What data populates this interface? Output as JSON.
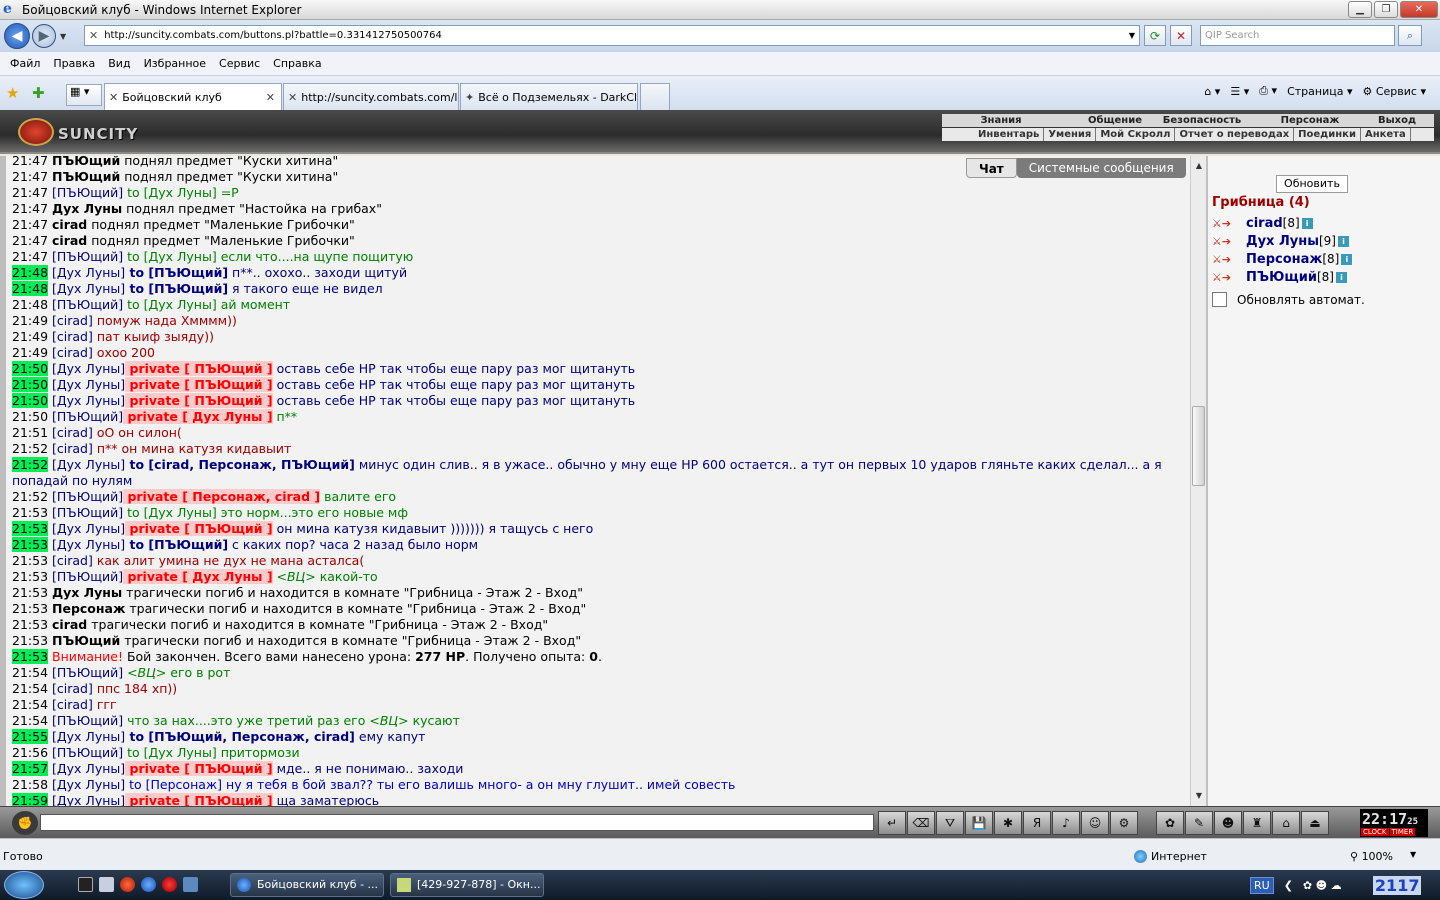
{
  "window": {
    "title": "Бойцовский клуб - Windows Internet Explorer"
  },
  "browser": {
    "url": "http://suncity.combats.com/buttons.pl?battle=0.331412750500764",
    "search_placeholder": "QIP Search",
    "menu": [
      "Файл",
      "Правка",
      "Вид",
      "Избранное",
      "Сервис",
      "Справка"
    ],
    "tabs": [
      {
        "label": "Бойцовский клуб",
        "active": true
      },
      {
        "label": "http://suncity.combats.com/l...",
        "active": false
      },
      {
        "label": "Всё о Подземельях - DarkCl...",
        "active": false
      }
    ],
    "tools": {
      "page_label": "Страница",
      "service_label": "Сервис"
    },
    "status_text": "Готово",
    "zone": "Интернет",
    "zoom": "100%"
  },
  "game": {
    "logo_text": "SUNCITY",
    "top_menu_1": [
      "Знания",
      "Общение",
      "Безопасность",
      "Персонаж",
      "Выход"
    ],
    "top_menu_2": [
      "Инвентарь",
      "Умения",
      "Мой Скролл",
      "Отчет о переводах",
      "Поединки",
      "Анкета"
    ],
    "chat_tabs": [
      "Чат",
      "Системные сообщения"
    ],
    "refresh_label": "Обновить",
    "room": {
      "name": "Грибница",
      "count": "(4)"
    },
    "users": [
      {
        "name": "cirad",
        "level": "[8]"
      },
      {
        "name": "Дух Луны",
        "level": "[9]"
      },
      {
        "name": "Персонаж",
        "level": "[8]"
      },
      {
        "name": "ПЪЮщий",
        "level": "[8]"
      }
    ],
    "auto_refresh_label": "Обновлять автомат.",
    "clock": {
      "time": "22:17",
      "seconds": "25",
      "label_clock": "CLOCK",
      "label_timer": "TIMER"
    }
  },
  "taskbar": {
    "buttons": [
      "Бойцовский клуб - ...",
      "[429-927-878] - Окн..."
    ],
    "lang": "RU",
    "time": "2117"
  },
  "chat": [
    {
      "t": "21:47",
      "hl": false,
      "parts": [
        {
          "k": "sysnick",
          "v": "ПЪЮщий"
        },
        {
          "k": "msg-gray",
          "v": " поднял предмет \"Куски хитина\""
        }
      ]
    },
    {
      "t": "21:47",
      "hl": false,
      "parts": [
        {
          "k": "sysnick",
          "v": "ПЪЮщий"
        },
        {
          "k": "msg-gray",
          "v": " поднял предмет \"Куски хитина\""
        }
      ]
    },
    {
      "t": "21:47",
      "hl": false,
      "parts": [
        {
          "k": "nick",
          "v": "[ПЪЮщий]"
        },
        {
          "k": "msg-green",
          "v": " to [Дух Луны] =P"
        }
      ]
    },
    {
      "t": "21:47",
      "hl": false,
      "parts": [
        {
          "k": "sysnick",
          "v": "Дух Луны"
        },
        {
          "k": "msg-gray",
          "v": " поднял предмет \"Настойка на грибах\""
        }
      ]
    },
    {
      "t": "21:47",
      "hl": false,
      "parts": [
        {
          "k": "sysnick",
          "v": "cirad"
        },
        {
          "k": "msg-gray",
          "v": " поднял предмет \"Маленькие Грибочки\""
        }
      ]
    },
    {
      "t": "21:47",
      "hl": false,
      "parts": [
        {
          "k": "sysnick",
          "v": "cirad"
        },
        {
          "k": "msg-gray",
          "v": " поднял предмет \"Маленькие Грибочки\""
        }
      ]
    },
    {
      "t": "21:47",
      "hl": false,
      "parts": [
        {
          "k": "nick",
          "v": "[ПЪЮщий]"
        },
        {
          "k": "msg-green",
          "v": " to [Дух Луны] если что....на щупе пощитую"
        }
      ]
    },
    {
      "t": "21:48",
      "hl": true,
      "parts": [
        {
          "k": "nick",
          "v": "[Дух Луны]"
        },
        {
          "k": "to",
          "v": " to [ПЪЮщий]"
        },
        {
          "k": "msg-navy",
          "v": " п**.. охохо.. заходи щитуй"
        }
      ]
    },
    {
      "t": "21:48",
      "hl": true,
      "parts": [
        {
          "k": "nick",
          "v": "[Дух Луны]"
        },
        {
          "k": "to",
          "v": " to [ПЪЮщий]"
        },
        {
          "k": "msg-navy",
          "v": " я такого еще не видел"
        }
      ]
    },
    {
      "t": "21:48",
      "hl": false,
      "parts": [
        {
          "k": "nick",
          "v": "[ПЪЮщий]"
        },
        {
          "k": "msg-green",
          "v": " to [Дух Луны] ай момент"
        }
      ]
    },
    {
      "t": "21:49",
      "hl": false,
      "parts": [
        {
          "k": "nick",
          "v": "[cirad]"
        },
        {
          "k": "msg-red",
          "v": " помуж нада Хмммм))"
        }
      ]
    },
    {
      "t": "21:49",
      "hl": false,
      "parts": [
        {
          "k": "nick",
          "v": "[cirad]"
        },
        {
          "k": "msg-red",
          "v": " пат кыиф зыяду))"
        }
      ]
    },
    {
      "t": "21:49",
      "hl": false,
      "parts": [
        {
          "k": "nick",
          "v": "[cirad]"
        },
        {
          "k": "msg-red",
          "v": " охоо 200"
        }
      ]
    },
    {
      "t": "21:50",
      "hl": true,
      "parts": [
        {
          "k": "nick",
          "v": "[Дух Луны]"
        },
        {
          "k": "priv",
          "v": " private [ ПЪЮщий ]"
        },
        {
          "k": "msg-navy",
          "v": " оставь себе НР так чтобы еще пару раз мог щитануть"
        }
      ]
    },
    {
      "t": "21:50",
      "hl": true,
      "parts": [
        {
          "k": "nick",
          "v": "[Дух Луны]"
        },
        {
          "k": "priv",
          "v": " private [ ПЪЮщий ]"
        },
        {
          "k": "msg-navy",
          "v": " оставь себе НР так чтобы еще пару раз мог щитануть"
        }
      ]
    },
    {
      "t": "21:50",
      "hl": true,
      "parts": [
        {
          "k": "nick",
          "v": "[Дух Луны]"
        },
        {
          "k": "priv",
          "v": " private [ ПЪЮщий ]"
        },
        {
          "k": "msg-navy",
          "v": " оставь себе НР так чтобы еще пару раз мог щитануть"
        }
      ]
    },
    {
      "t": "21:50",
      "hl": false,
      "parts": [
        {
          "k": "nick",
          "v": "[ПЪЮщий]"
        },
        {
          "k": "priv",
          "v": " private [ Дух Луны ]"
        },
        {
          "k": "msg-green",
          "v": " п**"
        }
      ]
    },
    {
      "t": "21:51",
      "hl": false,
      "parts": [
        {
          "k": "nick",
          "v": "[cirad]"
        },
        {
          "k": "msg-red",
          "v": " оО он силон("
        }
      ]
    },
    {
      "t": "21:52",
      "hl": false,
      "parts": [
        {
          "k": "nick",
          "v": "[cirad]"
        },
        {
          "k": "msg-red",
          "v": " п** он мина катузя кидавыит"
        }
      ]
    },
    {
      "t": "21:52",
      "hl": true,
      "wrap": true,
      "parts": [
        {
          "k": "nick",
          "v": "[Дух Луны]"
        },
        {
          "k": "to",
          "v": " to [cirad, Персонаж, ПЪЮщий]"
        },
        {
          "k": "msg-navy",
          "v": " минус один слив.. я в ужасе.. обычно у мну еще НР 600 остается.. а тут он первых 10 ударов гляньте каких сделал... а я попадай по нулям"
        }
      ]
    },
    {
      "t": "21:52",
      "hl": false,
      "parts": [
        {
          "k": "nick",
          "v": "[ПЪЮщий]"
        },
        {
          "k": "priv",
          "v": " private [ Персонаж, cirad ]"
        },
        {
          "k": "msg-green",
          "v": " валите его"
        }
      ]
    },
    {
      "t": "21:53",
      "hl": false,
      "parts": [
        {
          "k": "nick",
          "v": "[ПЪЮщий]"
        },
        {
          "k": "msg-green",
          "v": " to [Дух Луны] это норм...это его новые мф"
        }
      ]
    },
    {
      "t": "21:53",
      "hl": true,
      "parts": [
        {
          "k": "nick",
          "v": "[Дух Луны]"
        },
        {
          "k": "priv",
          "v": " private [ ПЪЮщий ]"
        },
        {
          "k": "msg-navy",
          "v": " он мина катузя кидавыит ))))))) я тащусь с него"
        }
      ]
    },
    {
      "t": "21:53",
      "hl": true,
      "parts": [
        {
          "k": "nick",
          "v": "[Дух Луны]"
        },
        {
          "k": "to",
          "v": " to [ПЪЮщий]"
        },
        {
          "k": "msg-navy",
          "v": " с каких пор? часа 2 назад было норм"
        }
      ]
    },
    {
      "t": "21:53",
      "hl": false,
      "parts": [
        {
          "k": "nick",
          "v": "[cirad]"
        },
        {
          "k": "msg-red",
          "v": " как алит умина не дух не мана асталса("
        }
      ]
    },
    {
      "t": "21:53",
      "hl": false,
      "parts": [
        {
          "k": "nick",
          "v": "[ПЪЮщий]"
        },
        {
          "k": "priv",
          "v": " private [ Дух Луны ]"
        },
        {
          "k": "vc",
          "v": " <ВЦ>"
        },
        {
          "k": "msg-green",
          "v": " какой-то"
        }
      ]
    },
    {
      "t": "21:53",
      "hl": false,
      "parts": [
        {
          "k": "sysnick",
          "v": "Дух Луны"
        },
        {
          "k": "msg-gray",
          "v": " трагически погиб и находится в комнате \"Грибница - Этаж 2 - Вход\""
        }
      ]
    },
    {
      "t": "21:53",
      "hl": false,
      "parts": [
        {
          "k": "sysnick",
          "v": "Персонаж"
        },
        {
          "k": "msg-gray",
          "v": " трагически погиб и находится в комнате \"Грибница - Этаж 2 - Вход\""
        }
      ]
    },
    {
      "t": "21:53",
      "hl": false,
      "parts": [
        {
          "k": "sysnick",
          "v": "cirad"
        },
        {
          "k": "msg-gray",
          "v": " трагически погиб и находится в комнате \"Грибница - Этаж 2 - Вход\""
        }
      ]
    },
    {
      "t": "21:53",
      "hl": false,
      "parts": [
        {
          "k": "sysnick",
          "v": "ПЪЮщий"
        },
        {
          "k": "msg-gray",
          "v": " трагически погиб и находится в комнате \"Грибница - Этаж 2 - Вход\""
        }
      ]
    },
    {
      "t": "21:53",
      "hl": true,
      "parts": [
        {
          "k": "alert",
          "v": "Внимание!"
        },
        {
          "k": "msg-gray",
          "v": " Бой закончен. Всего вами нанесено урона: "
        },
        {
          "k": "sysnick",
          "v": "277 HP"
        },
        {
          "k": "msg-gray",
          "v": ". Получено опыта: "
        },
        {
          "k": "sysnick",
          "v": "0"
        },
        {
          "k": "msg-gray",
          "v": "."
        }
      ]
    },
    {
      "t": "21:54",
      "hl": false,
      "parts": [
        {
          "k": "nick",
          "v": "[ПЪЮщий]"
        },
        {
          "k": "vc",
          "v": " <ВЦ>"
        },
        {
          "k": "msg-green",
          "v": " его в рот"
        }
      ]
    },
    {
      "t": "21:54",
      "hl": false,
      "parts": [
        {
          "k": "nick",
          "v": "[cirad]"
        },
        {
          "k": "msg-red",
          "v": " ппс 184 хп))"
        }
      ]
    },
    {
      "t": "21:54",
      "hl": false,
      "parts": [
        {
          "k": "nick",
          "v": "[cirad]"
        },
        {
          "k": "msg-red",
          "v": " ггг"
        }
      ]
    },
    {
      "t": "21:54",
      "hl": false,
      "parts": [
        {
          "k": "nick",
          "v": "[ПЪЮщий]"
        },
        {
          "k": "msg-green",
          "v": " что за нах....это уже третий раз его "
        },
        {
          "k": "vc",
          "v": "<ВЦ>"
        },
        {
          "k": "msg-green",
          "v": " кусают"
        }
      ]
    },
    {
      "t": "21:55",
      "hl": true,
      "parts": [
        {
          "k": "nick",
          "v": "[Дух Луны]"
        },
        {
          "k": "to",
          "v": " to [ПЪЮщий, Персонаж, cirad]"
        },
        {
          "k": "msg-navy",
          "v": " ему капут"
        }
      ]
    },
    {
      "t": "21:56",
      "hl": false,
      "parts": [
        {
          "k": "nick",
          "v": "[ПЪЮщий]"
        },
        {
          "k": "msg-green",
          "v": " to [Дух Луны] притормози"
        }
      ]
    },
    {
      "t": "21:57",
      "hl": true,
      "parts": [
        {
          "k": "nick",
          "v": "[Дух Луны]"
        },
        {
          "k": "priv",
          "v": " private [ ПЪЮщий ]"
        },
        {
          "k": "msg-navy",
          "v": " мде.. я не понимаю.. заходи"
        }
      ]
    },
    {
      "t": "21:58",
      "hl": false,
      "parts": [
        {
          "k": "nick",
          "v": "[Дух Луны]"
        },
        {
          "k": "msg-blue",
          "v": " to [Персонаж] ну я тебя в бой звал?? ты его валишь много- а он мну глушит.. имей совесть"
        }
      ]
    },
    {
      "t": "21:59",
      "hl": true,
      "parts": [
        {
          "k": "nick",
          "v": "[Дух Луны]"
        },
        {
          "k": "priv",
          "v": " private [ ПЪЮщий ]"
        },
        {
          "k": "msg-navy",
          "v": " ща заматерюсь"
        }
      ]
    }
  ]
}
